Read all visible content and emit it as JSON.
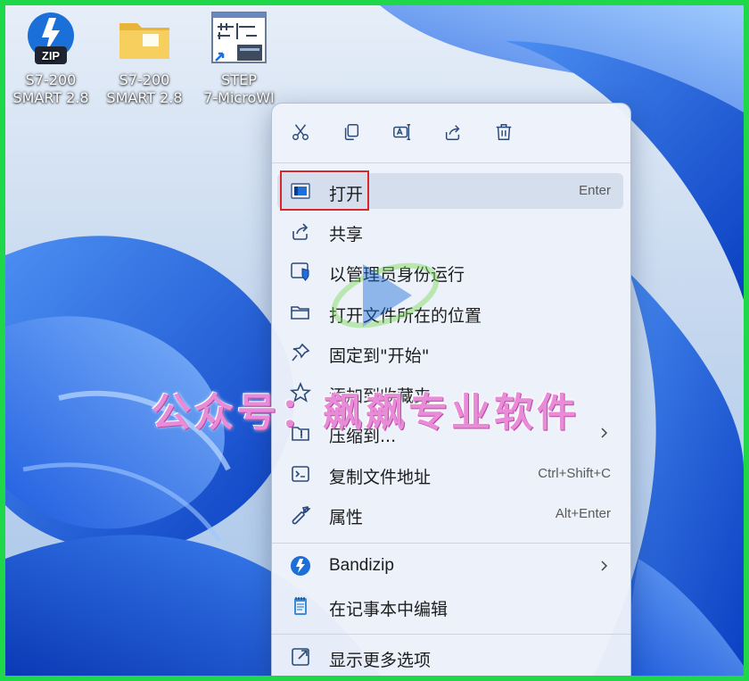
{
  "desktop": {
    "icons": [
      {
        "name": "zip-archive",
        "line1": "S7-200",
        "line2": "SMART 2.8",
        "badge": "ZIP"
      },
      {
        "name": "folder",
        "line1": "S7-200",
        "line2": "SMART 2.8"
      },
      {
        "name": "step7-microwin",
        "line1": "STEP",
        "line2": "7-MicroWI"
      }
    ]
  },
  "context_menu": {
    "toolbar": [
      "cut-icon",
      "copy-icon",
      "rename-icon",
      "share-icon",
      "delete-icon"
    ],
    "items": [
      {
        "label": "打开",
        "shortcut": "Enter",
        "icon": "open-app-icon",
        "highlighted": true
      },
      {
        "label": "共享",
        "icon": "share-icon"
      },
      {
        "label": "以管理员身份运行",
        "icon": "shield-icon"
      },
      {
        "label": "打开文件所在的位置",
        "icon": "folder-icon"
      },
      {
        "label": "固定到\"开始\"",
        "icon": "pin-icon"
      },
      {
        "label": "添加到收藏夹",
        "icon": "star-icon"
      },
      {
        "label": "压缩到...",
        "icon": "compress-icon",
        "submenu": true
      },
      {
        "label": "复制文件地址",
        "shortcut": "Ctrl+Shift+C",
        "icon": "copy-path-icon"
      },
      {
        "label": "属性",
        "shortcut": "Alt+Enter",
        "icon": "wrench-icon"
      },
      {
        "label": "Bandizip",
        "icon": "bandizip-icon",
        "submenu": true
      },
      {
        "label": "在记事本中编辑",
        "icon": "notepad-icon"
      },
      {
        "label": "显示更多选项",
        "icon": "more-options-icon"
      }
    ]
  },
  "watermark": "公众号：飙飙专业软件",
  "colors": {
    "frame": "#1fd84a",
    "highlight_box": "#d8262d",
    "accent": "#1e6fd9",
    "watermark": "#e88cd7"
  }
}
